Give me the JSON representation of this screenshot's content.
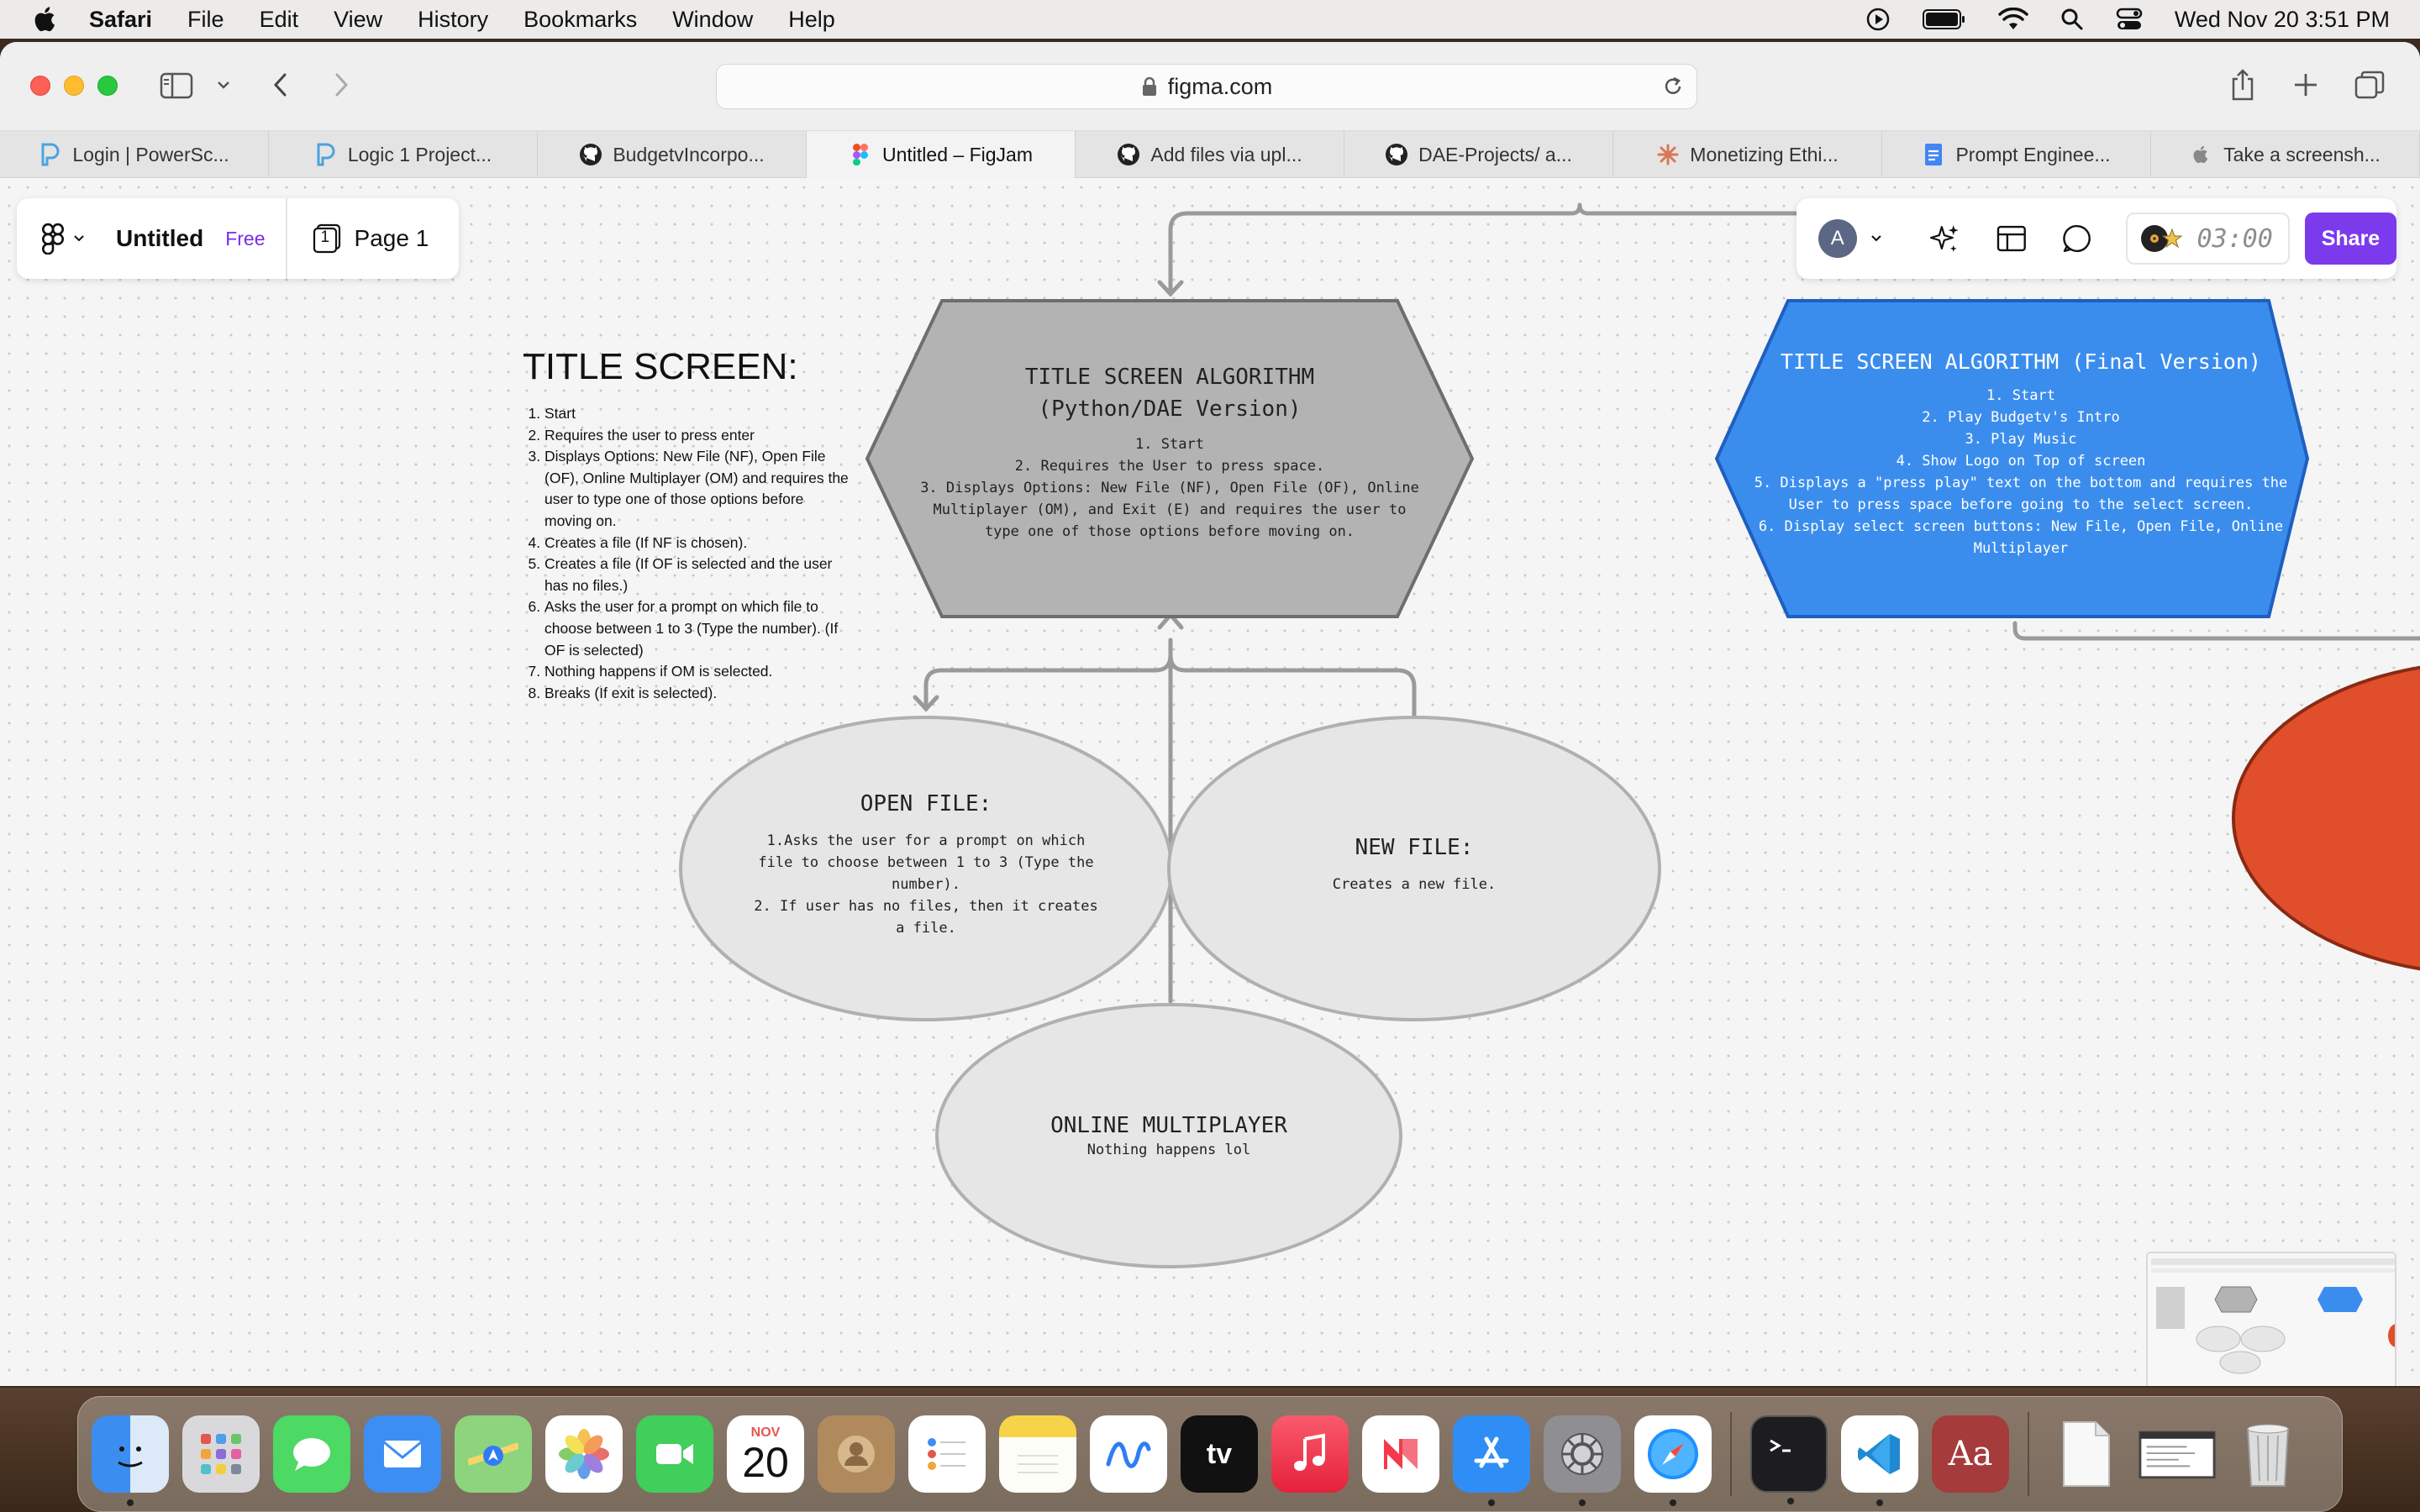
{
  "menubar": {
    "app_name": "Safari",
    "items": [
      "File",
      "Edit",
      "View",
      "History",
      "Bookmarks",
      "Window",
      "Help"
    ],
    "datetime": "Wed Nov 20  3:51 PM"
  },
  "browser": {
    "url": "figma.com",
    "tabs": [
      {
        "label": "Login | PowerSc...",
        "favicon": "powerschool-icon",
        "active": false
      },
      {
        "label": "Logic 1 Project...",
        "favicon": "powerschool-icon",
        "active": false
      },
      {
        "label": "BudgetvIncorpo...",
        "favicon": "github-icon",
        "active": false
      },
      {
        "label": "Untitled – FigJam",
        "favicon": "figma-icon",
        "active": true
      },
      {
        "label": "Add files via upl...",
        "favicon": "github-icon",
        "active": false
      },
      {
        "label": "DAE-Projects/ a...",
        "favicon": "github-icon",
        "active": false
      },
      {
        "label": "Monetizing Ethi...",
        "favicon": "claude-icon",
        "active": false
      },
      {
        "label": "Prompt Enginee...",
        "favicon": "google-docs-icon",
        "active": false
      },
      {
        "label": "Take a screensh...",
        "favicon": "apple-icon",
        "active": false
      }
    ]
  },
  "figjam": {
    "file_name": "Untitled",
    "plan_badge": "Free",
    "page_label": "Page 1",
    "page_number": "1",
    "avatar_initial": "A",
    "timer": "03:00",
    "share_label": "Share"
  },
  "diagram": {
    "notes": {
      "title": "TITLE SCREEN:",
      "items": [
        "Start",
        "Requires the user to press enter",
        "Displays Options: New File (NF), Open File (OF), Online Multiplayer (OM) and requires the user to type one of those options before moving on.",
        "Creates a file (If NF is chosen).",
        "Creates a file (If OF is selected and the user has no files.)",
        "Asks the user for a prompt on which file to choose between 1 to 3 (Type the number). (If OF is selected)",
        "Nothing happens if OM is selected.",
        "Breaks (If exit is selected)."
      ]
    },
    "python_hex": {
      "title": "TITLE SCREEN ALGORITHM (Python/DAE Version)",
      "lines": [
        "1. Start",
        "2. Requires the User to press space.",
        "3. Displays Options: New File (NF), Open File (OF), Online Multiplayer (OM), and Exit (E) and requires the user to type one of those options before moving on."
      ],
      "color": "#b3b3b3"
    },
    "final_hex": {
      "title": "TITLE SCREEN ALGORITHM (Final Version)",
      "lines": [
        "1. Start",
        "2. Play Budgetv's Intro",
        "3. Play Music",
        "4. Show Logo on Top of screen",
        "5. Displays a \"press play\" text on the bottom and requires the User to press space before going to the select screen.",
        "6. Display select screen buttons: New File, Open File, Online Multiplayer"
      ],
      "color": "#3b8ded"
    },
    "open_file": {
      "title": "OPEN FILE:",
      "lines": [
        "1.Asks the user for a prompt on which file to choose between 1 to 3 (Type the number).",
        "2. If user has no files, then it creates a file."
      ]
    },
    "new_file": {
      "title": "NEW FILE:",
      "body": "Creates a new file."
    },
    "online": {
      "title": "ONLINE MULTIPLAYER",
      "body": "Nothing happens lol"
    },
    "ellipse_color": "#e6e6e6",
    "red_shape_color": "#e04e2b"
  },
  "dock": {
    "calendar_month": "NOV",
    "calendar_day": "20",
    "apps": [
      "Finder",
      "Launchpad",
      "Messages",
      "Mail",
      "Maps",
      "Photos",
      "FaceTime",
      "Calendar",
      "Contacts",
      "Reminders",
      "Notes",
      "Freeform",
      "TV",
      "Music",
      "News",
      "App Store",
      "System Settings",
      "Safari",
      "Terminal",
      "Visual Studio Code",
      "Dictionary",
      "Document",
      "Screenshot",
      "Trash"
    ],
    "tv_label": "tv",
    "dictionary_label": "Aa"
  }
}
